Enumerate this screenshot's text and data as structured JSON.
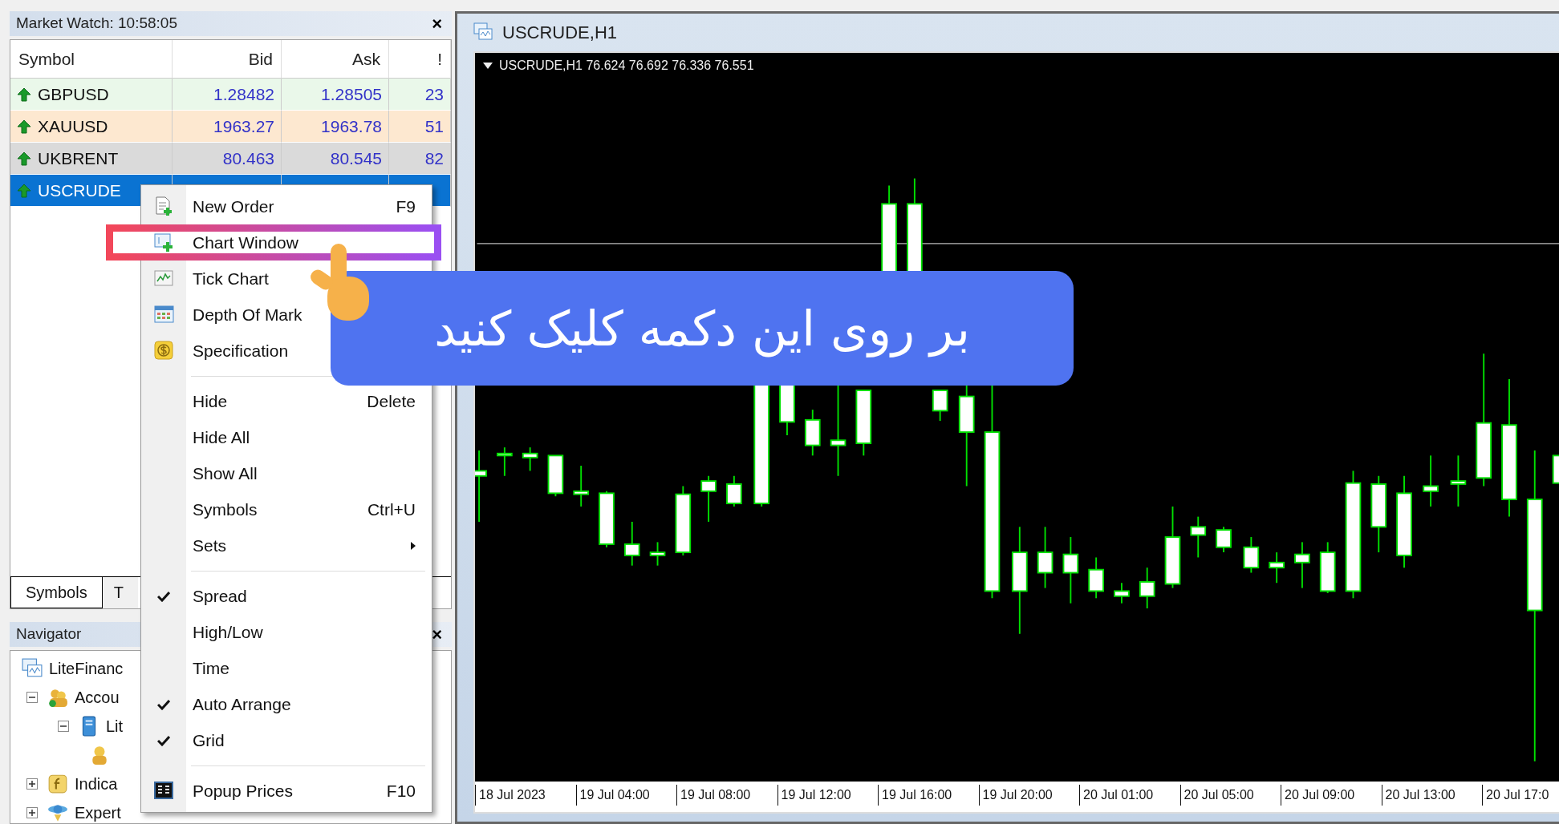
{
  "market_watch": {
    "title": "Market Watch: 10:58:05",
    "close": "×",
    "columns": [
      "Symbol",
      "Bid",
      "Ask",
      "!"
    ],
    "rows": [
      {
        "symbol": "GBPUSD",
        "bid": "1.28482",
        "ask": "1.28505",
        "spread": "23",
        "color": "#eaf8ea",
        "selected": false
      },
      {
        "symbol": "XAUUSD",
        "bid": "1963.27",
        "ask": "1963.78",
        "spread": "51",
        "color": "#fde8d0",
        "selected": false
      },
      {
        "symbol": "UKBRENT",
        "bid": "80.463",
        "ask": "80.545",
        "spread": "82",
        "color": "#dadada",
        "selected": false
      },
      {
        "symbol": "USCRUDE",
        "selected": true
      }
    ],
    "tabs": [
      {
        "label": "Symbols",
        "selected": true
      },
      {
        "label": "T",
        "selected": false
      }
    ]
  },
  "navigator": {
    "title": "Navigator",
    "close": "×",
    "tree": [
      {
        "label": "LiteFinanc",
        "children": [
          {
            "label": "Accou",
            "expanded": true,
            "children": [
              {
                "label": "Lit",
                "expanded": true,
                "children": [
                  {
                    "kind": "account"
                  }
                ]
              }
            ]
          },
          {
            "label": "Indica",
            "expanded": false
          },
          {
            "label": "Expert",
            "expanded": false
          }
        ]
      }
    ]
  },
  "context_menu": [
    {
      "kind": "item",
      "label": "New Order",
      "shortcut": "F9",
      "checked": false,
      "highlighted": false
    },
    {
      "kind": "item",
      "label": "Chart Window",
      "checked": false,
      "highlighted": true
    },
    {
      "kind": "item",
      "label": "Tick Chart",
      "checked": false,
      "highlighted": false
    },
    {
      "kind": "item",
      "label": "Depth Of Mark",
      "checked": false,
      "highlighted": false
    },
    {
      "kind": "item",
      "label": "Specification",
      "checked": false,
      "highlighted": false
    },
    {
      "kind": "separator"
    },
    {
      "kind": "item",
      "label": "Hide",
      "shortcut": "Delete",
      "checked": false,
      "highlighted": false
    },
    {
      "kind": "item",
      "label": "Hide All",
      "checked": false,
      "highlighted": false
    },
    {
      "kind": "item",
      "label": "Show All",
      "checked": false,
      "highlighted": false
    },
    {
      "kind": "item",
      "label": "Symbols",
      "shortcut": "Ctrl+U",
      "checked": false,
      "highlighted": false
    },
    {
      "kind": "submenu",
      "label": "Sets",
      "checked": false,
      "highlighted": false
    },
    {
      "kind": "separator"
    },
    {
      "kind": "item",
      "label": "Spread",
      "checked": true,
      "highlighted": false
    },
    {
      "kind": "item",
      "label": "High/Low",
      "checked": false,
      "highlighted": false
    },
    {
      "kind": "item",
      "label": "Time",
      "checked": false,
      "highlighted": false
    },
    {
      "kind": "item",
      "label": "Auto Arrange",
      "checked": true,
      "highlighted": false
    },
    {
      "kind": "item",
      "label": "Grid",
      "checked": true,
      "highlighted": false
    },
    {
      "kind": "separator"
    },
    {
      "kind": "item",
      "label": "Popup Prices",
      "shortcut": "F10",
      "checked": false,
      "highlighted": false
    }
  ],
  "callout": {
    "text": "بر روی این دکمه کلیک کنید"
  },
  "chart_window": {
    "title": "USCRUDE,H1",
    "header": "USCRUDE,H1  76.624 76.692 76.336 76.551",
    "time_labels": [
      "18 Jul 2023",
      "19 Jul 04:00",
      "19 Jul 08:00",
      "19 Jul 12:00",
      "19 Jul 16:00",
      "19 Jul 20:00",
      "20 Jul 01:00",
      "20 Jul 05:00",
      "20 Jul 09:00",
      "20 Jul 13:00",
      "20 Jul 17:0"
    ]
  }
}
